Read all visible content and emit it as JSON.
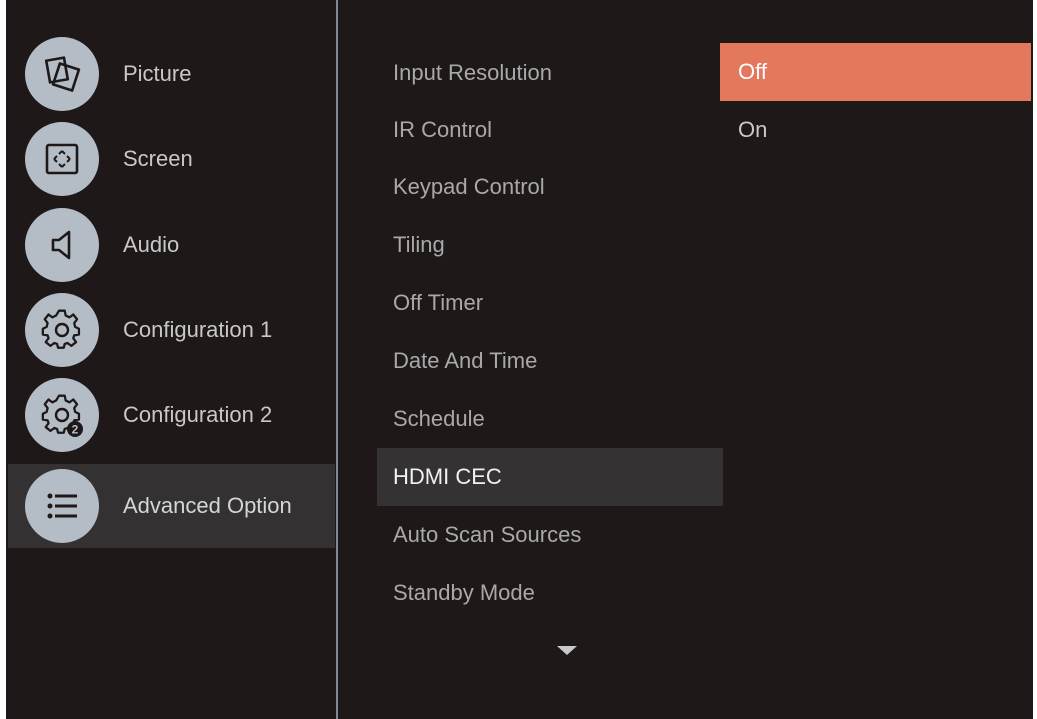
{
  "sidebar": {
    "items": [
      {
        "label": "Picture",
        "icon": "picture-icon"
      },
      {
        "label": "Screen",
        "icon": "screen-icon"
      },
      {
        "label": "Audio",
        "icon": "audio-icon"
      },
      {
        "label": "Configuration 1",
        "icon": "gear-icon"
      },
      {
        "label": "Configuration 2",
        "icon": "gear-2-icon",
        "badge": "2"
      },
      {
        "label": "Advanced Option",
        "icon": "list-icon",
        "active": true
      }
    ]
  },
  "menu": {
    "items": [
      "Input Resolution",
      "IR Control",
      "Keypad Control",
      "Tiling",
      "Off Timer",
      "Date And Time",
      "Schedule",
      "HDMI CEC",
      "Auto Scan Sources",
      "Standby Mode"
    ],
    "selected": "HDMI CEC",
    "more_indicator": "chevron-down-icon"
  },
  "options": {
    "items": [
      "Off",
      "On"
    ],
    "selected": "Off"
  },
  "colors": {
    "background": "#1e1818",
    "highlight_row": "#343232",
    "accent": "#e3785c",
    "icon_circle": "#b4bcc6",
    "divider": "#7a8a96"
  }
}
